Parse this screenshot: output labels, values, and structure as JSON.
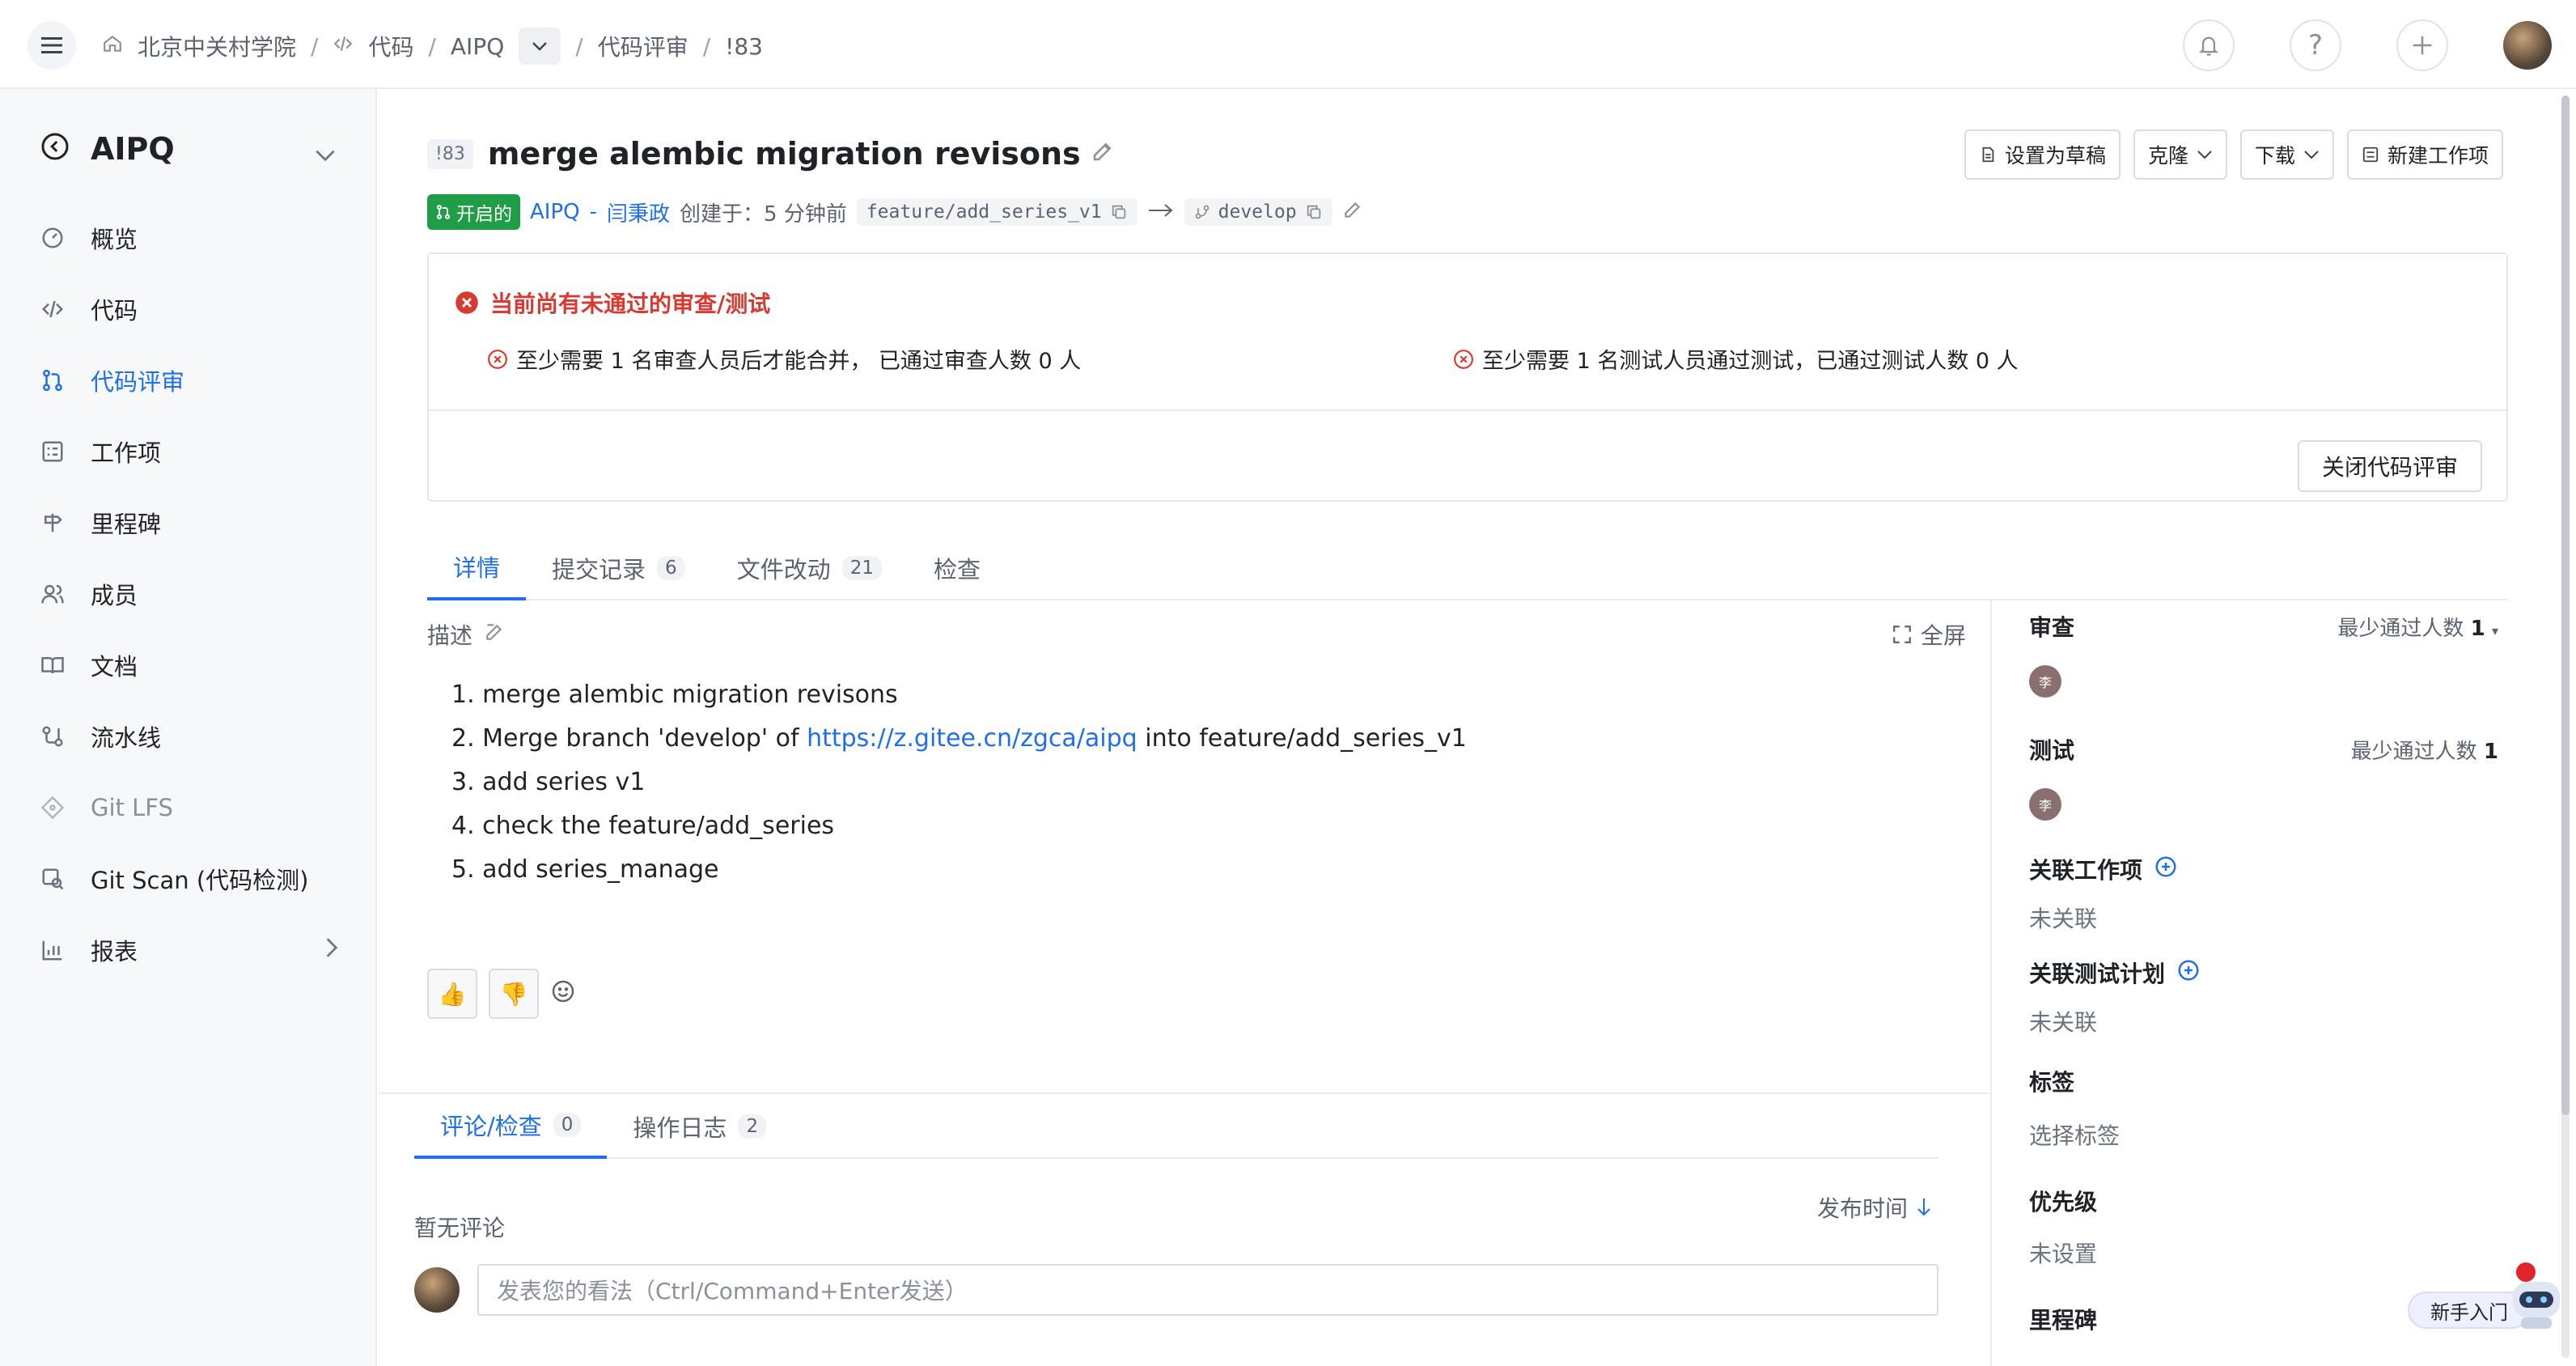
{
  "breadcrumb": {
    "items": [
      "北京中关村学院",
      "代码",
      "AIPQ",
      "代码评审",
      "!83"
    ]
  },
  "sidebar": {
    "project_name": "AIPQ",
    "items": [
      {
        "label": "概览",
        "icon": "gauge-icon"
      },
      {
        "label": "代码",
        "icon": "code-icon"
      },
      {
        "label": "代码评审",
        "icon": "merge-request-icon"
      },
      {
        "label": "工作项",
        "icon": "checklist-icon"
      },
      {
        "label": "里程碑",
        "icon": "signpost-icon"
      },
      {
        "label": "成员",
        "icon": "users-icon"
      },
      {
        "label": "文档",
        "icon": "book-icon"
      },
      {
        "label": "流水线",
        "icon": "pipeline-icon"
      },
      {
        "label": "Git LFS",
        "icon": "git-lfs-icon"
      },
      {
        "label": "Git Scan (代码检测)",
        "icon": "scan-icon"
      },
      {
        "label": "报表",
        "icon": "bar-chart-icon"
      }
    ],
    "active_index": 2
  },
  "pr": {
    "number": "!83",
    "title": "merge alembic migration revisons",
    "status": "开启的",
    "repo": "AIPQ",
    "separator": "-",
    "author": "闫秉政",
    "created": "创建于：5 分钟前",
    "source_branch": "feature/add_series_v1",
    "target_branch": "develop"
  },
  "actions": {
    "draft": "设置为草稿",
    "clone": "克隆",
    "download": "下载",
    "new_work_item": "新建工作项"
  },
  "alert": {
    "title": "当前尚有未通过的审查/测试",
    "review_req": "至少需要 1 名审查人员后才能合并， 已通过审查人数 0 人",
    "test_req": "至少需要 1 名测试人员通过测试，已通过测试人数 0 人",
    "close_button": "关闭代码评审"
  },
  "tabs": [
    {
      "label": "详情",
      "count": ""
    },
    {
      "label": "提交记录",
      "count": "6"
    },
    {
      "label": "文件改动",
      "count": "21"
    },
    {
      "label": "检查",
      "count": ""
    }
  ],
  "description": {
    "label": "描述",
    "fullscreen": "全屏",
    "items": [
      "1. merge alembic migration revisons",
      "2. Merge branch 'develop' of ",
      "3. add series v1",
      "4. check the feature/add_series",
      "5. add series_manage"
    ],
    "item2_link": "https://z.gitee.cn/zgca/aipq",
    "item2_tail": " into feature/add_series_v1"
  },
  "comment_tabs": [
    {
      "label": "评论/检查",
      "count": "0"
    },
    {
      "label": "操作日志",
      "count": "2"
    }
  ],
  "comments": {
    "empty": "暂无评论",
    "sort": "发布时间",
    "placeholder": "发表您的看法（Ctrl/Command+Enter发送）"
  },
  "right_panel": {
    "review_title": "审查",
    "review_min": "最少通过人数",
    "review_min_value": "1",
    "reviewer_initial": "李",
    "test_title": "测试",
    "test_min": "最少通过人数",
    "test_min_value": "1",
    "tester_initial": "李",
    "linked_items_title": "关联工作项",
    "linked_items_value": "未关联",
    "linked_plans_title": "关联测试计划",
    "linked_plans_value": "未关联",
    "labels_title": "标签",
    "labels_value": "选择标签",
    "priority_title": "优先级",
    "priority_value": "未设置",
    "milestone_title": "里程碑"
  },
  "helper": {
    "newbie": "新手入门"
  },
  "colors": {
    "accent": "#1e6fe8",
    "open_badge": "#1f9e47",
    "error": "#d83931"
  }
}
